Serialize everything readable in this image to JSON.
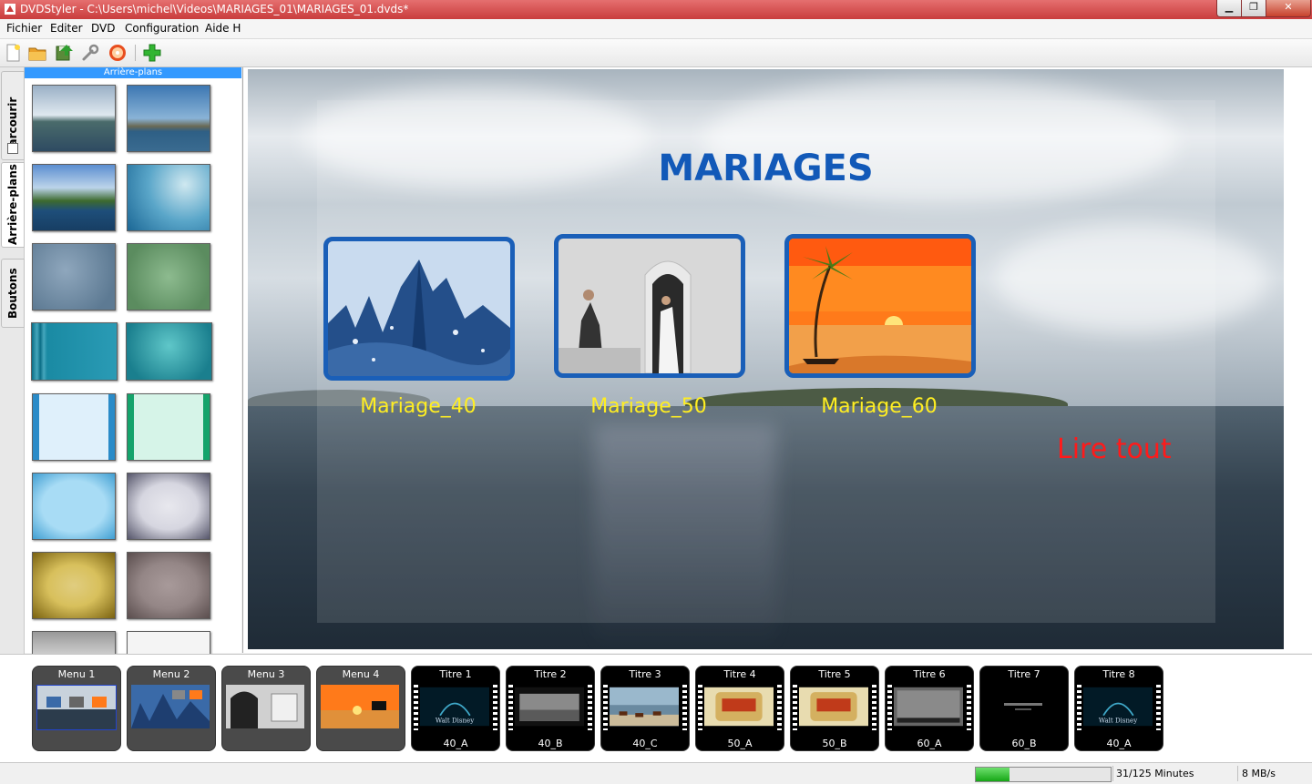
{
  "window": {
    "title": "DVDStyler - C:\\Users\\michel\\Videos\\MARIAGES_01\\MARIAGES_01.dvds*",
    "min_label": "▁",
    "max_label": "❐",
    "close_label": "✕"
  },
  "menubar": {
    "items": [
      "Fichier",
      "Editer",
      "DVD",
      "Configuration",
      "Aide H"
    ]
  },
  "toolbar": {
    "icons": [
      "new-file-icon",
      "open-folder-icon",
      "save-icon",
      "settings-wrench-icon",
      "burn-disc-icon",
      "add-icon"
    ]
  },
  "side_tabs": [
    "Parcourir",
    "Arrière-plans",
    "Boutons"
  ],
  "panel": {
    "header": "Arrière-plans",
    "scroll_position": 0.05
  },
  "canvas": {
    "title": "MARIAGES",
    "buttons": [
      {
        "label": "Mariage_40"
      },
      {
        "label": "Mariage_50"
      },
      {
        "label": "Mariage_60"
      }
    ],
    "play_all": "Lire tout"
  },
  "filmstrip": [
    {
      "title": "Menu 1",
      "type": "menu",
      "bottom": ""
    },
    {
      "title": "Menu 2",
      "type": "menu",
      "bottom": ""
    },
    {
      "title": "Menu 3",
      "type": "menu",
      "bottom": ""
    },
    {
      "title": "Menu 4",
      "type": "menu",
      "bottom": ""
    },
    {
      "title": "Titre 1",
      "type": "title",
      "bottom": "40_A"
    },
    {
      "title": "Titre 2",
      "type": "title",
      "bottom": "40_B"
    },
    {
      "title": "Titre 3",
      "type": "title",
      "bottom": "40_C"
    },
    {
      "title": "Titre 4",
      "type": "title",
      "bottom": "50_A"
    },
    {
      "title": "Titre 5",
      "type": "title",
      "bottom": "50_B"
    },
    {
      "title": "Titre 6",
      "type": "title",
      "bottom": "60_A"
    },
    {
      "title": "Titre 7",
      "type": "title",
      "bottom": "60_B"
    },
    {
      "title": "Titre 8",
      "type": "title",
      "bottom": "40_A"
    }
  ],
  "status": {
    "progress_fraction": 0.248,
    "minutes": "31/125 Minutes",
    "rate": "8 MB/s"
  },
  "colors": {
    "accent": "#3399ff",
    "menu_title": "#1259b8",
    "button_frame": "#1a5fb8",
    "button_label": "#ffee22",
    "play_all": "#ff1a1a"
  }
}
